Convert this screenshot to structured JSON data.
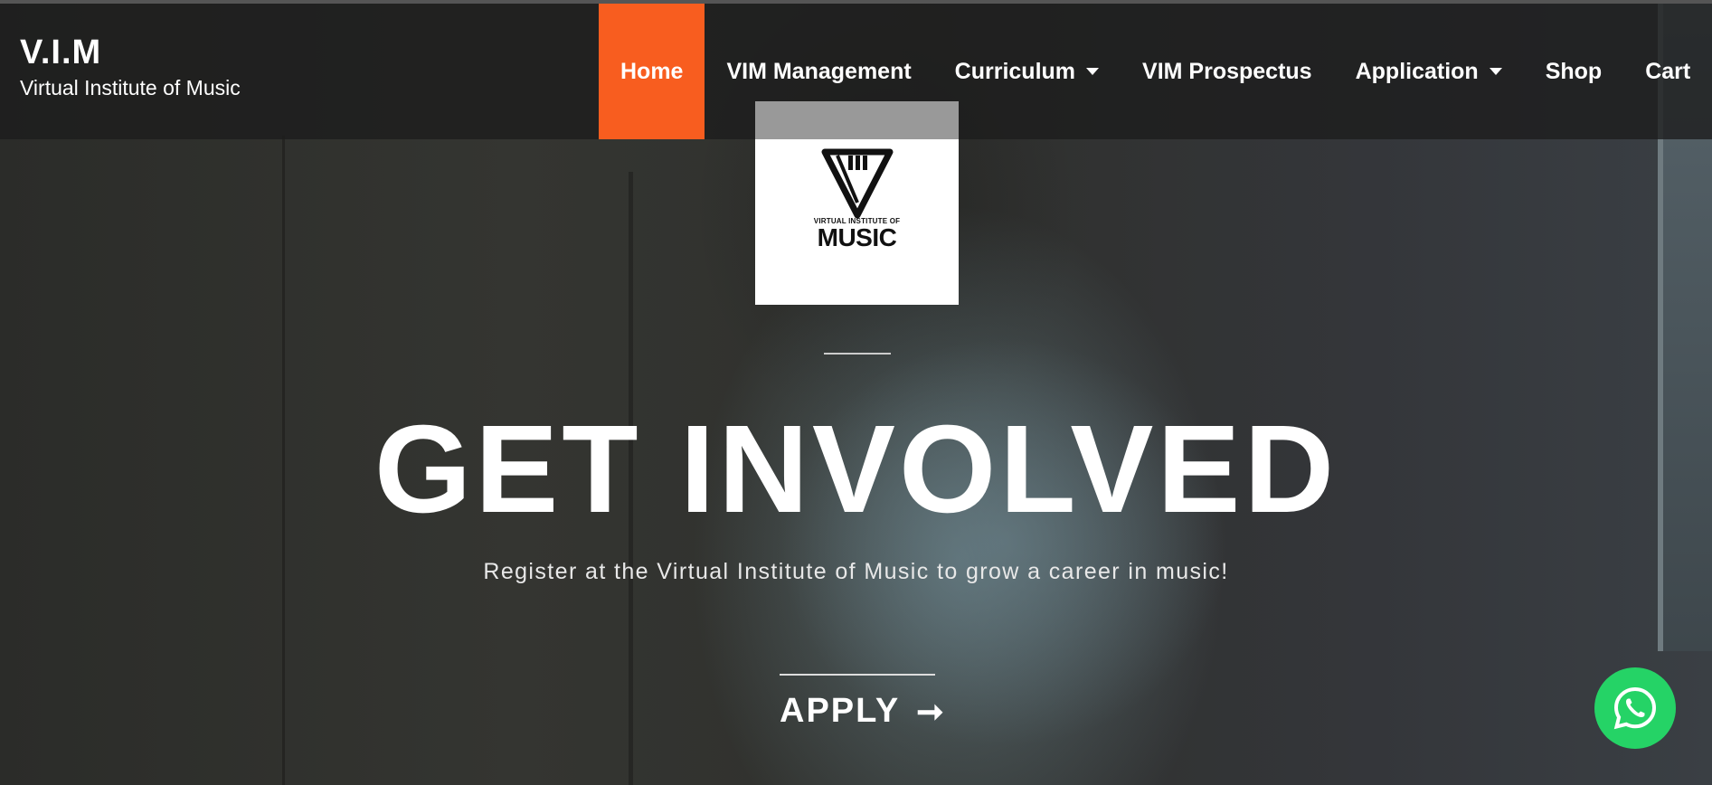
{
  "brand": {
    "title": "V.I.M",
    "subtitle": "Virtual Institute of Music"
  },
  "nav": {
    "items": [
      {
        "label": "Home",
        "active": true
      },
      {
        "label": "VIM Management"
      },
      {
        "label": "Curriculum",
        "dropdown": true
      },
      {
        "label": "VIM Prospectus"
      },
      {
        "label": "Application",
        "dropdown": true
      },
      {
        "label": "Shop"
      },
      {
        "label": "Cart"
      }
    ]
  },
  "logo": {
    "small_text": "VIRTUAL INSTITUTE OF",
    "big_text": "MUSIC"
  },
  "hero": {
    "headline": "GET INVOLVED",
    "subtitle": "Register at the Virtual Institute of Music to grow a career in music!",
    "cta_label": "APPLY",
    "cta_icon": "arrow-right-icon"
  },
  "colors": {
    "accent": "#f85d1f",
    "whatsapp": "#25d366"
  },
  "icons": {
    "whatsapp": "whatsapp-icon"
  }
}
